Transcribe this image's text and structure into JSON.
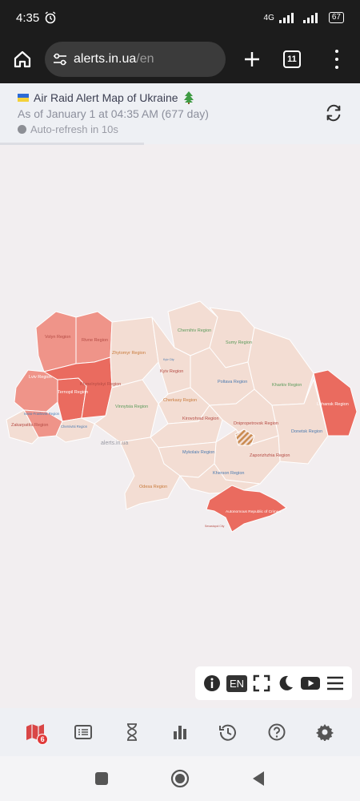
{
  "status": {
    "time": "4:35",
    "net1": "4G",
    "battery": "67"
  },
  "browser": {
    "url_host": "alerts.in.ua",
    "url_path": "/en",
    "tab_count": "11"
  },
  "header": {
    "title": "Air Raid Alert Map of Ukraine",
    "subtitle": "As of January 1 at 04:35 AM (677 day)",
    "autorefresh": "Auto-refresh in 10s"
  },
  "map": {
    "watermark": "alerts.in.ua",
    "colors": {
      "base": "#f3ddd3",
      "alert": "#ef9489",
      "alert_strong": "#ea6b5f",
      "border": "#ffffff"
    },
    "regions": {
      "volyn": "Volyn Region",
      "rivne": "Rivne Region",
      "zhytomyr": "Zhytomyr Region",
      "chernihiv": "Chernihiv Region",
      "sumy": "Sumy Region",
      "kyiv": "Kyiv Region",
      "kyiv_city": "Kyiv City",
      "lviv": "Lviv Region",
      "khmelnytskyi": "Khmelnytskyi Region",
      "ternopil": "Ternopil Region",
      "poltava": "Poltava Region",
      "kharkiv": "Kharkiv Region",
      "luhansk": "Luhansk Region",
      "ivano_frankivsk": "Ivano-Frankivsk Region",
      "chernivtsi": "Chernivtsi Region",
      "zakarpattia": "Zakarpattia Region",
      "vinnytsia": "Vinnytsia Region",
      "cherkasy": "Cherkasy Region",
      "kirovohrad": "Kirovohrad Region",
      "dnipropetrovsk": "Dnipropetrovsk Region",
      "donetsk": "Donetsk Region",
      "mykolaiv": "Mykolaiv Region",
      "zaporizhzhia": "Zaporizhzhia Region",
      "kherson": "Kherson Region",
      "odesa": "Odesa Region",
      "crimea": "Autonomous Republic of Crimea",
      "sevastopol": "Sevastopol City"
    }
  },
  "tools": {
    "lang": "EN"
  },
  "nav": {
    "alert_count": "6"
  }
}
